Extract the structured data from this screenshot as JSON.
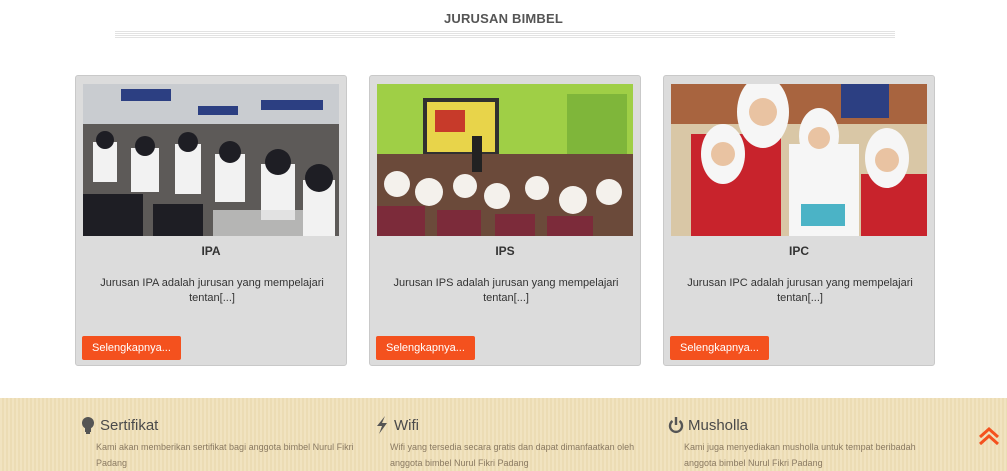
{
  "section": {
    "title": "JURUSAN BIMBEL"
  },
  "cards": [
    {
      "title": "IPA",
      "desc": "Jurusan IPA adalah jurusan yang mempelajari tentan[...]",
      "button": "Selengkapnya..."
    },
    {
      "title": "IPS",
      "desc": "Jurusan IPS adalah jurusan yang mempelajari tentan[...]",
      "button": "Selengkapnya..."
    },
    {
      "title": "IPC",
      "desc": "Jurusan IPC adalah jurusan yang mempelajari tentan[...]",
      "button": "Selengkapnya..."
    }
  ],
  "features": [
    {
      "icon": "lightbulb-icon",
      "title": "Sertifikat",
      "text": "Kami akan memberikan sertifikat bagi anggota bimbel Nurul Fikri Padang"
    },
    {
      "icon": "lightning-icon",
      "title": "Wifi",
      "text": "Wifi yang tersedia secara gratis dan dapat dimanfaatkan oleh anggota bimbel Nurul Fikri Padang"
    },
    {
      "icon": "power-icon",
      "title": "Musholla",
      "text": "Kami juga menyediakan musholla untuk tempat beribadah anggota bimbel Nurul Fikri Padang"
    }
  ],
  "colors": {
    "button": "#f4511e",
    "card_bg": "#dcdcdc",
    "footer_bg": "#efe0b9",
    "accent": "#f4511e"
  },
  "scroll_top_icon": "double-chevron-up-icon"
}
